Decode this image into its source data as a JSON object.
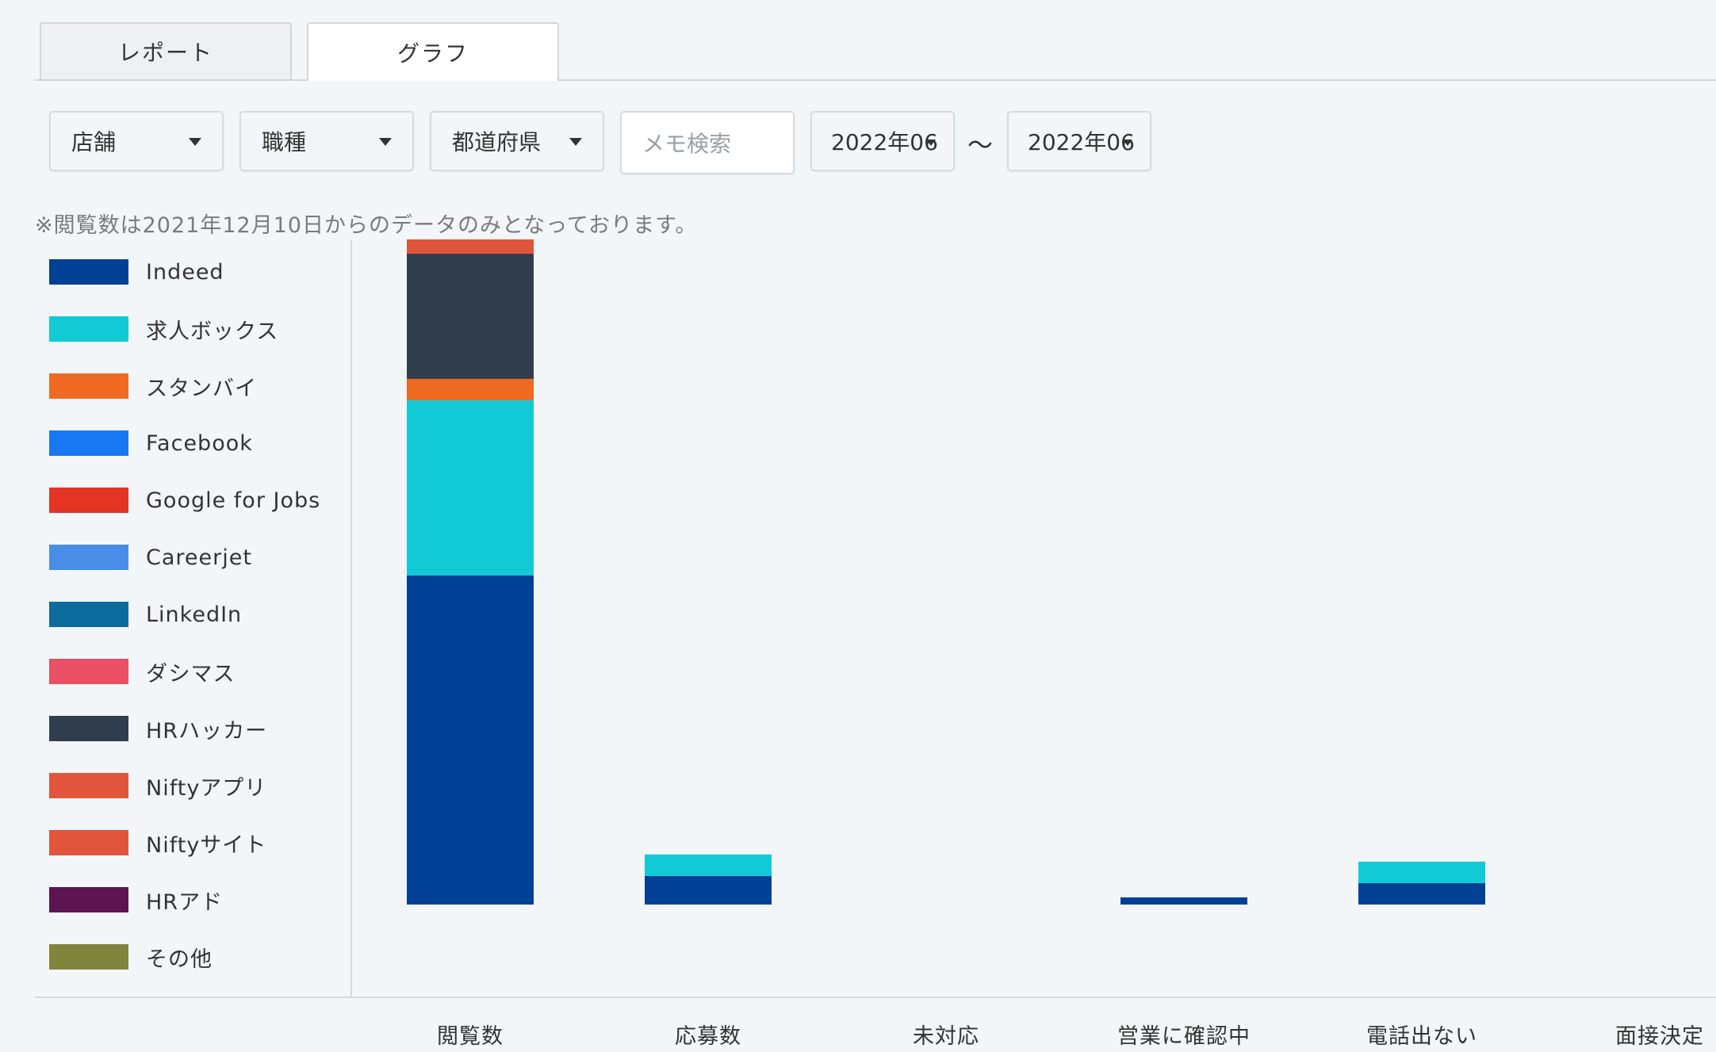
{
  "tabs": [
    {
      "label": "レポート"
    },
    {
      "label": "グラフ",
      "active": true
    }
  ],
  "filters": {
    "store": "店舗",
    "job_type": "職種",
    "prefecture": "都道府県",
    "memo_placeholder": "メモ検索",
    "date_from": "2022年06",
    "date_separator": "～",
    "date_to": "2022年06"
  },
  "note": "※閲覧数は2021年12月10日からのデータのみとなっております。",
  "legend": [
    {
      "label": "Indeed",
      "color": "#004195"
    },
    {
      "label": "求人ボックス",
      "color": "#12cad6"
    },
    {
      "label": "スタンバイ",
      "color": "#f06a21"
    },
    {
      "label": "Facebook",
      "color": "#1877f2"
    },
    {
      "label": "Google for Jobs",
      "color": "#e43424"
    },
    {
      "label": "Careerjet",
      "color": "#4a8de8"
    },
    {
      "label": "LinkedIn",
      "color": "#0e6b9e"
    },
    {
      "label": "ダシマス",
      "color": "#ea4f63"
    },
    {
      "label": "HRハッカー",
      "color": "#2f3d4d"
    },
    {
      "label": "Niftyアプリ",
      "color": "#e0553b"
    },
    {
      "label": "Niftyサイト",
      "color": "#e0553b"
    },
    {
      "label": "HRアド",
      "color": "#5d1551"
    },
    {
      "label": "その他",
      "color": "#80843d"
    }
  ],
  "chart_data": {
    "type": "bar",
    "stacked": true,
    "categories": [
      "閲覧数",
      "応募数",
      "未対応",
      "営業に確認中",
      "電話出ない",
      "面接決定"
    ],
    "series": [
      {
        "name": "Indeed",
        "color": "#004195",
        "values": [
          46,
          4,
          0,
          1,
          3,
          0
        ]
      },
      {
        "name": "求人ボックス",
        "color": "#12cad6",
        "values": [
          24.5,
          3,
          0,
          0,
          3,
          0
        ]
      },
      {
        "name": "スタンバイ",
        "color": "#f06a21",
        "values": [
          3,
          0,
          0,
          0,
          0,
          0
        ]
      },
      {
        "name": "HRハッカー",
        "color": "#2f3d4d",
        "values": [
          17.5,
          0,
          0,
          0,
          0,
          0
        ]
      },
      {
        "name": "Niftyサイト",
        "color": "#e0553b",
        "values": [
          2,
          0,
          0,
          0,
          0,
          0
        ]
      }
    ],
    "ylim": [
      0,
      93
    ],
    "grid": false,
    "legend_position": "left"
  }
}
